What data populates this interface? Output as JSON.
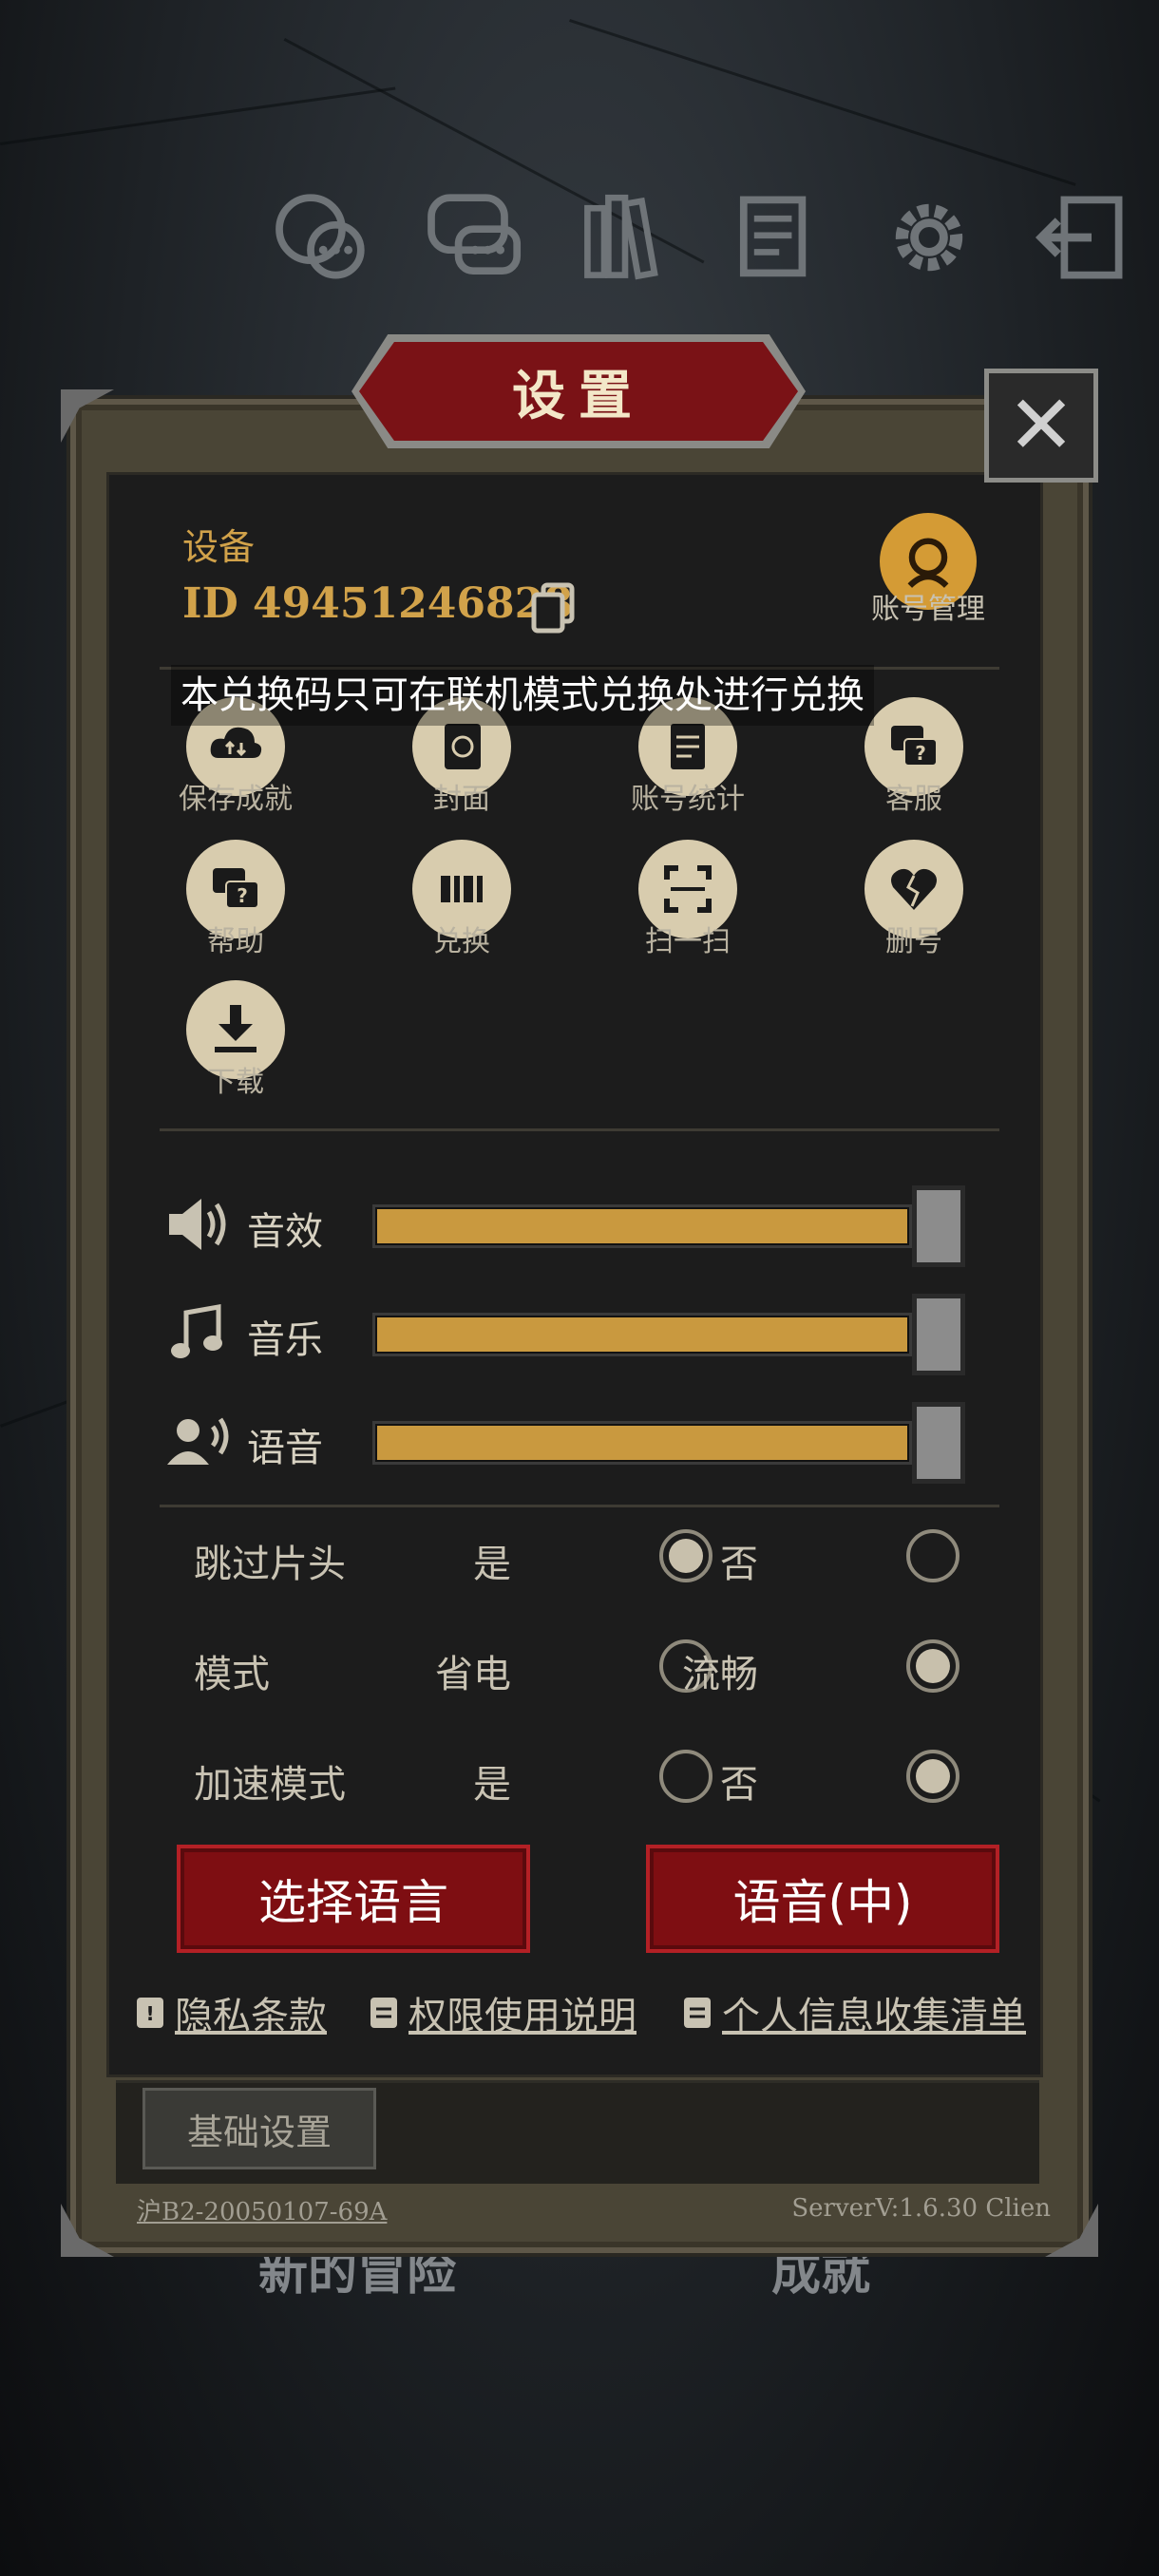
{
  "toolbar": {
    "icons": [
      "chat-bubbles-icon",
      "message-icon",
      "books-icon",
      "notes-icon",
      "gear-icon",
      "exit-icon"
    ]
  },
  "dialog": {
    "title": "设置",
    "close_symbol": "✕"
  },
  "device": {
    "section_label": "设备",
    "id_text": "ID 49451246828",
    "account_label": "账号管理"
  },
  "toast": "本兑换码只可在联机模式兑换处进行兑换",
  "grid": [
    {
      "label": "保存成就",
      "icon": "cloud-sync-icon"
    },
    {
      "label": "封面",
      "icon": "cover-icon"
    },
    {
      "label": "账号统计",
      "icon": "document-icon"
    },
    {
      "label": "客服",
      "icon": "help-chat-icon"
    },
    {
      "label": "帮助",
      "icon": "help-chat-icon"
    },
    {
      "label": "兑换",
      "icon": "barcode-icon"
    },
    {
      "label": "扫一扫",
      "icon": "scan-icon"
    },
    {
      "label": "删号",
      "icon": "broken-heart-icon"
    },
    {
      "label": "下载",
      "icon": "download-icon"
    }
  ],
  "sliders": [
    {
      "label": "音效",
      "icon": "speaker-icon",
      "value": 1.0
    },
    {
      "label": "音乐",
      "icon": "music-note-icon",
      "value": 1.0
    },
    {
      "label": "语音",
      "icon": "voice-icon",
      "value": 1.0
    }
  ],
  "options": [
    {
      "label": "跳过片头",
      "a": "是",
      "b": "否",
      "selected": "a"
    },
    {
      "label": "模式",
      "a": "省电",
      "b": "流畅",
      "selected": "b"
    },
    {
      "label": "加速模式",
      "a": "是",
      "b": "否",
      "selected": "b"
    }
  ],
  "buttons": {
    "select_language": "选择语言",
    "voice_language": "语音(中)"
  },
  "links": {
    "privacy": "隐私条款",
    "permissions": "权限使用说明",
    "personal_info": "个人信息收集清单"
  },
  "tabs": {
    "basic": "基础设置"
  },
  "footer": {
    "license": "沪B2-20050107-69A",
    "version": "ServerV:1.6.30 Clien"
  },
  "background_text": {
    "left": "新的冒险",
    "right": "成就"
  },
  "colors": {
    "accent_gold": "#d1a24a",
    "button_red": "#7e0e12",
    "slider_fill": "#c9993f"
  }
}
